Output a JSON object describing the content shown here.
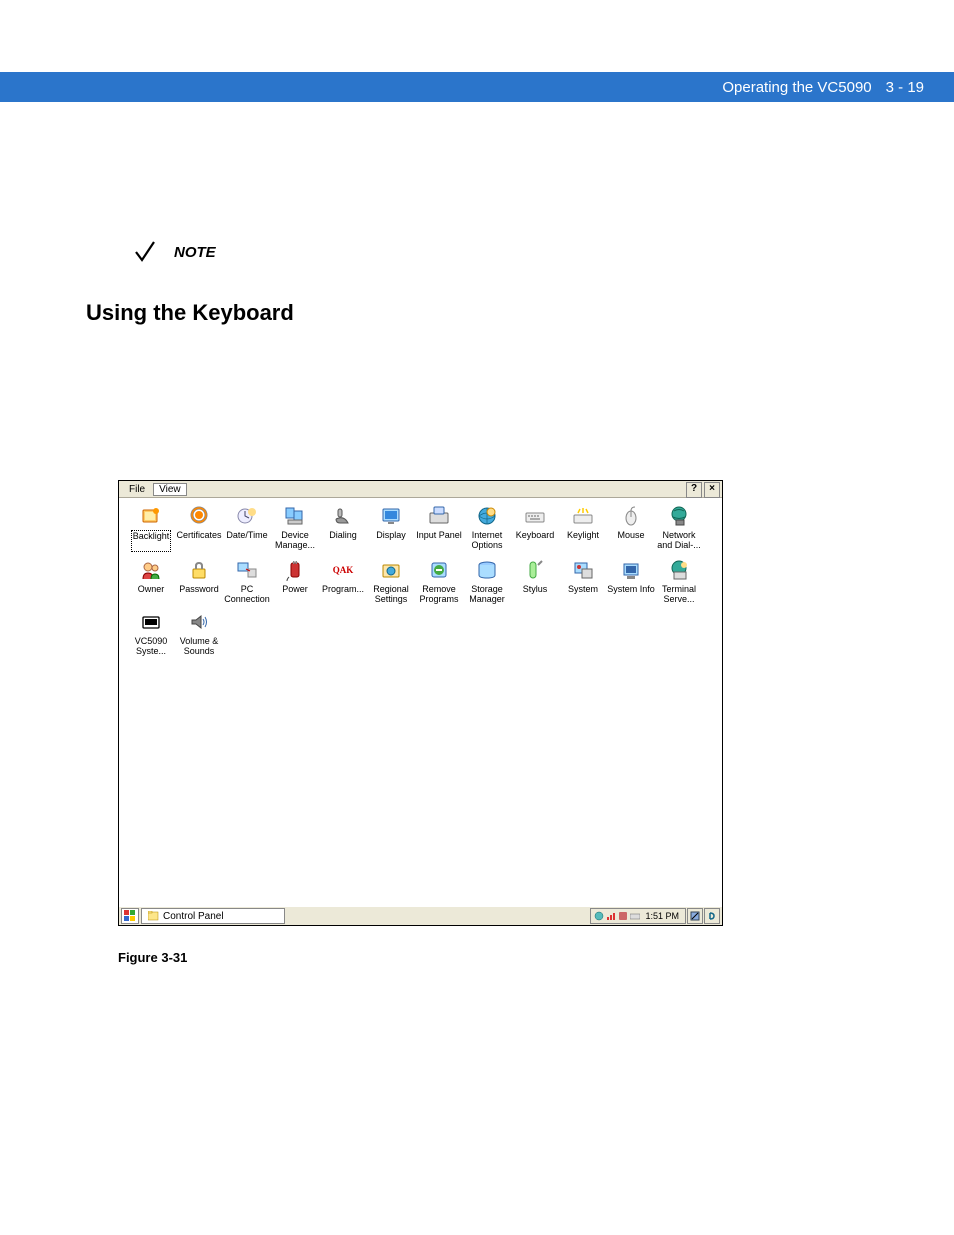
{
  "header": {
    "title": "Operating the VC5090",
    "pageno": "3 - 19"
  },
  "note": {
    "label": "NOTE"
  },
  "section": {
    "heading": "Using the Keyboard"
  },
  "win": {
    "menu": {
      "file": "File",
      "view": "View"
    },
    "titlebar": {
      "help": "?",
      "close": "×"
    },
    "taskbar": {
      "task_label": "Control Panel",
      "time": "1:51 PM"
    },
    "icons": [
      {
        "label": "Backlight",
        "selected": true,
        "glyph": "backlight"
      },
      {
        "label": "Certificates",
        "glyph": "cert"
      },
      {
        "label": "Date/Time",
        "glyph": "datetime"
      },
      {
        "label": "Device Manage...",
        "glyph": "device"
      },
      {
        "label": "Dialing",
        "glyph": "dialing"
      },
      {
        "label": "Display",
        "glyph": "display"
      },
      {
        "label": "Input Panel",
        "glyph": "input"
      },
      {
        "label": "Internet Options",
        "glyph": "inet"
      },
      {
        "label": "Keyboard",
        "glyph": "keyboard"
      },
      {
        "label": "Keylight",
        "glyph": "keylight"
      },
      {
        "label": "Mouse",
        "glyph": "mouse"
      },
      {
        "label": "Network and Dial-...",
        "glyph": "network"
      },
      {
        "label": "Owner",
        "glyph": "owner"
      },
      {
        "label": "Password",
        "glyph": "password"
      },
      {
        "label": "PC Connection",
        "glyph": "pcconn"
      },
      {
        "label": "Power",
        "glyph": "power"
      },
      {
        "label": "Program...",
        "glyph": "program",
        "textIcon": "QAK"
      },
      {
        "label": "Regional Settings",
        "glyph": "regional"
      },
      {
        "label": "Remove Programs",
        "glyph": "remove"
      },
      {
        "label": "Storage Manager",
        "glyph": "storage"
      },
      {
        "label": "Stylus",
        "glyph": "stylus"
      },
      {
        "label": "System",
        "glyph": "system"
      },
      {
        "label": "System Info",
        "glyph": "sysinfo"
      },
      {
        "label": "Terminal Serve...",
        "glyph": "terminal"
      },
      {
        "label": "VC5090 Syste...",
        "glyph": "vc5090"
      },
      {
        "label": "Volume & Sounds",
        "glyph": "volume"
      }
    ]
  },
  "figure": {
    "caption": "Figure 3-31"
  }
}
